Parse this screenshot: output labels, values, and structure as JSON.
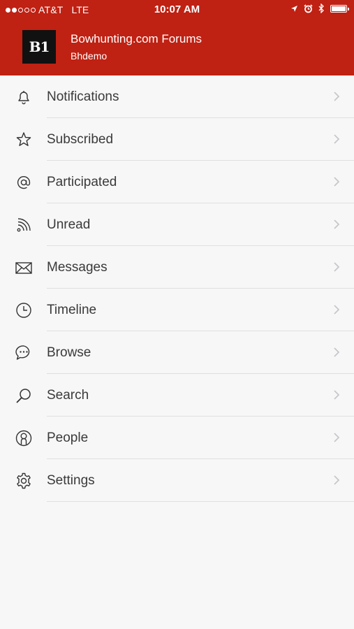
{
  "status_bar": {
    "carrier": "AT&T",
    "network": "LTE",
    "time": "10:07 AM",
    "signal_bars": 2,
    "battery_level": 1.0
  },
  "header": {
    "logo_text": "B1",
    "forum_title": "Bowhunting.com Forums",
    "username": "Bhdemo",
    "background_color": "#bf2113"
  },
  "menu": [
    {
      "label": "Notifications",
      "icon": "bell-icon"
    },
    {
      "label": "Subscribed",
      "icon": "star-icon"
    },
    {
      "label": "Participated",
      "icon": "at-icon"
    },
    {
      "label": "Unread",
      "icon": "rss-icon"
    },
    {
      "label": "Messages",
      "icon": "envelope-icon"
    },
    {
      "label": "Timeline",
      "icon": "clock-icon"
    },
    {
      "label": "Browse",
      "icon": "chat-bubble-icon"
    },
    {
      "label": "Search",
      "icon": "magnifier-icon"
    },
    {
      "label": "People",
      "icon": "person-icon"
    },
    {
      "label": "Settings",
      "icon": "gear-icon"
    }
  ]
}
